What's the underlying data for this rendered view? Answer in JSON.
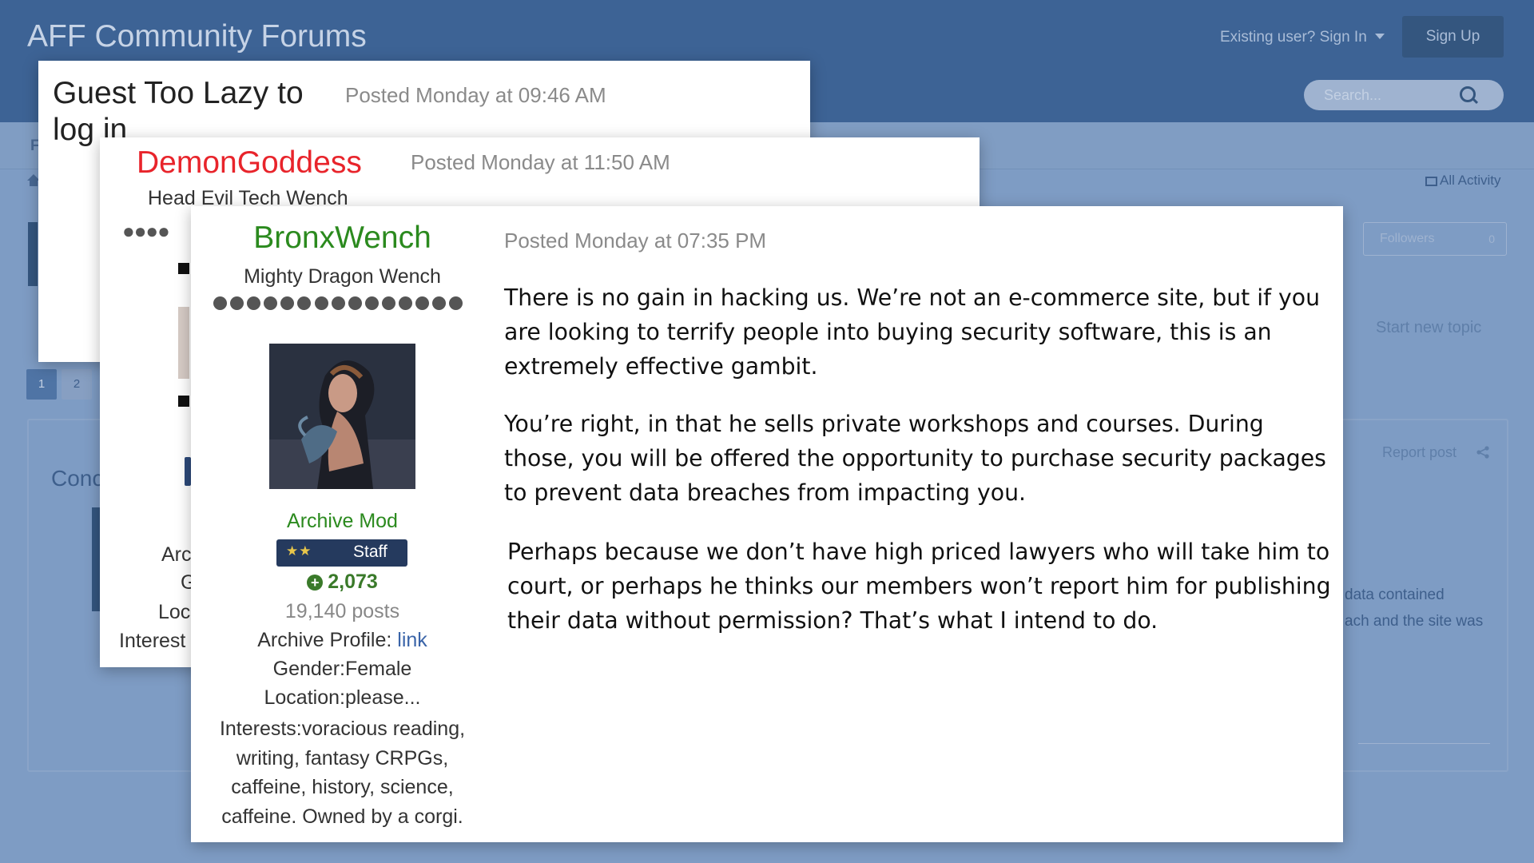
{
  "header": {
    "site_title": "AFF Community Forums",
    "signin_label": "Existing user? Sign In",
    "signup_label": "Sign Up",
    "search_placeholder": "Search..."
  },
  "page": {
    "nav_partial": "F",
    "all_activity": "All Activity",
    "followers_label": "Followers",
    "followers_count": "0",
    "stub_text": "s",
    "start_new_topic": "Start new topic",
    "pages": [
      "1",
      "2"
    ],
    "post_title_partial": "Conc",
    "report_post": "Report post",
    "body_fragment_1": "data contained",
    "body_fragment_2": "ach and the site was"
  },
  "posts": [
    {
      "author": "Guest Too Lazy to log in",
      "posted": "Posted Monday at 09:46 AM"
    },
    {
      "author": "DemonGoddess",
      "author_color": "#e8242b",
      "posted": "Posted Monday at 11:50 AM",
      "rank": "Head Evil Tech Wench",
      "pips": "●●●●",
      "profile_partial": [
        "Arc",
        "G",
        "Loc",
        "Interest"
      ]
    },
    {
      "author": "BronxWench",
      "author_color": "#2b8a1e",
      "posted": "Posted Monday at 07:35 PM",
      "rank": "Mighty Dragon Wench",
      "group": "Archive Mod",
      "badge_stars": "★★",
      "badge_label": "Staff",
      "reputation": "2,073",
      "post_count": "19,140 posts",
      "archive_profile_label": "Archive Profile: ",
      "archive_profile_link": "link",
      "gender": "Gender:Female",
      "location": "Location:please...",
      "interests": "Interests:voracious reading, writing, fantasy CRPGs, caffeine, history, science, caffeine. Owned by a corgi.",
      "paragraphs": [
        "There is no gain in hacking us. We’re not an e-commerce site, but if you are looking to terrify people into buying security software, this is an extremely effective gambit.",
        "You’re right, in that he sells private workshops and courses. During those, you will be offered the opportunity to purchase security packages to prevent data breaches from impacting you.",
        "Perhaps because we don’t have high priced lawyers who will take him to court, or perhaps he thinks our members won’t report him for publishing their data without permission? That’s what I intend to do."
      ]
    }
  ]
}
